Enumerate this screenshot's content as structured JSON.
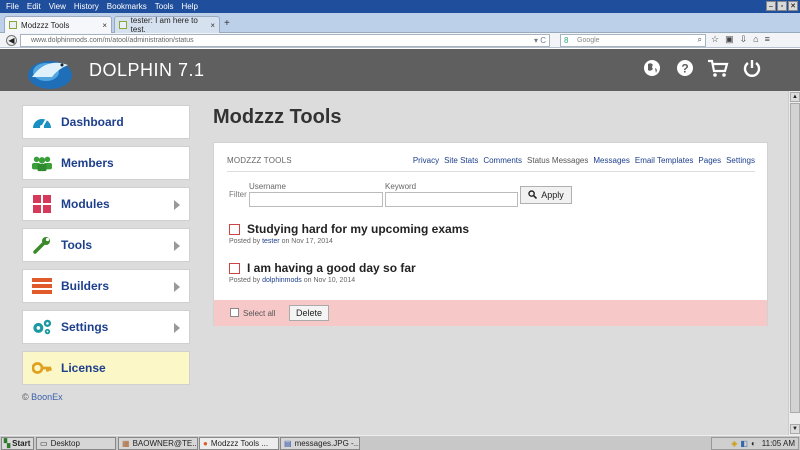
{
  "menubar": {
    "items": [
      "File",
      "Edit",
      "View",
      "History",
      "Bookmarks",
      "Tools",
      "Help"
    ]
  },
  "tabs": [
    {
      "label": "Modzzz Tools",
      "active": true
    },
    {
      "label": "tester: I am here to test.",
      "active": false
    }
  ],
  "newtab_label": "+",
  "url": "www.dolphinmods.com/m/atool/administration/status",
  "search": {
    "placeholder": "Google"
  },
  "header": {
    "brand": "DOLPHIN 7.1"
  },
  "sidebar": {
    "items": [
      {
        "label": "Dashboard",
        "icon": "speedometer-icon",
        "color": "#1a8fc2",
        "arrow": false
      },
      {
        "label": "Members",
        "icon": "users-icon",
        "color": "#3a9e3a",
        "arrow": false
      },
      {
        "label": "Modules",
        "icon": "grid-icon",
        "color": "#d63a5a",
        "arrow": true
      },
      {
        "label": "Tools",
        "icon": "wrench-icon",
        "color": "#3a8a2a",
        "arrow": true
      },
      {
        "label": "Builders",
        "icon": "bars-icon",
        "color": "#e05a2a",
        "arrow": true
      },
      {
        "label": "Settings",
        "icon": "gears-icon",
        "color": "#1a9aa0",
        "arrow": true
      },
      {
        "label": "License",
        "icon": "key-icon",
        "color": "#e0a020",
        "arrow": false
      }
    ],
    "copyright_symbol": "©",
    "copyright_link": "BoonEx"
  },
  "page": {
    "title": "Modzzz Tools"
  },
  "panel": {
    "title": "MODZZZ TOOLS",
    "menu": [
      "Privacy",
      "Site Stats",
      "Comments",
      "Status Messages",
      "Messages",
      "Email Templates",
      "Pages",
      "Settings"
    ],
    "active_menu": "Status Messages",
    "filter": {
      "label": "Filter",
      "username_label": "Username",
      "keyword_label": "Keyword",
      "apply_label": "Apply"
    },
    "posts": [
      {
        "text": "Studying hard for my upcoming exams",
        "prefix": "Posted by",
        "author": "tester",
        "date": "on Nov 17, 2014"
      },
      {
        "text": "I am having a good day so far",
        "prefix": "Posted by",
        "author": "dolphinmods",
        "date": "on Nov 10, 2014"
      }
    ],
    "select_all_label": "Select all",
    "delete_label": "Delete"
  },
  "taskbar": {
    "start": "Start",
    "items": [
      "Desktop",
      "BAOWNER@TE...",
      "Modzzz Tools ...",
      "messages.JPG -..."
    ],
    "active_index": 2,
    "clock": "11:05 AM"
  }
}
